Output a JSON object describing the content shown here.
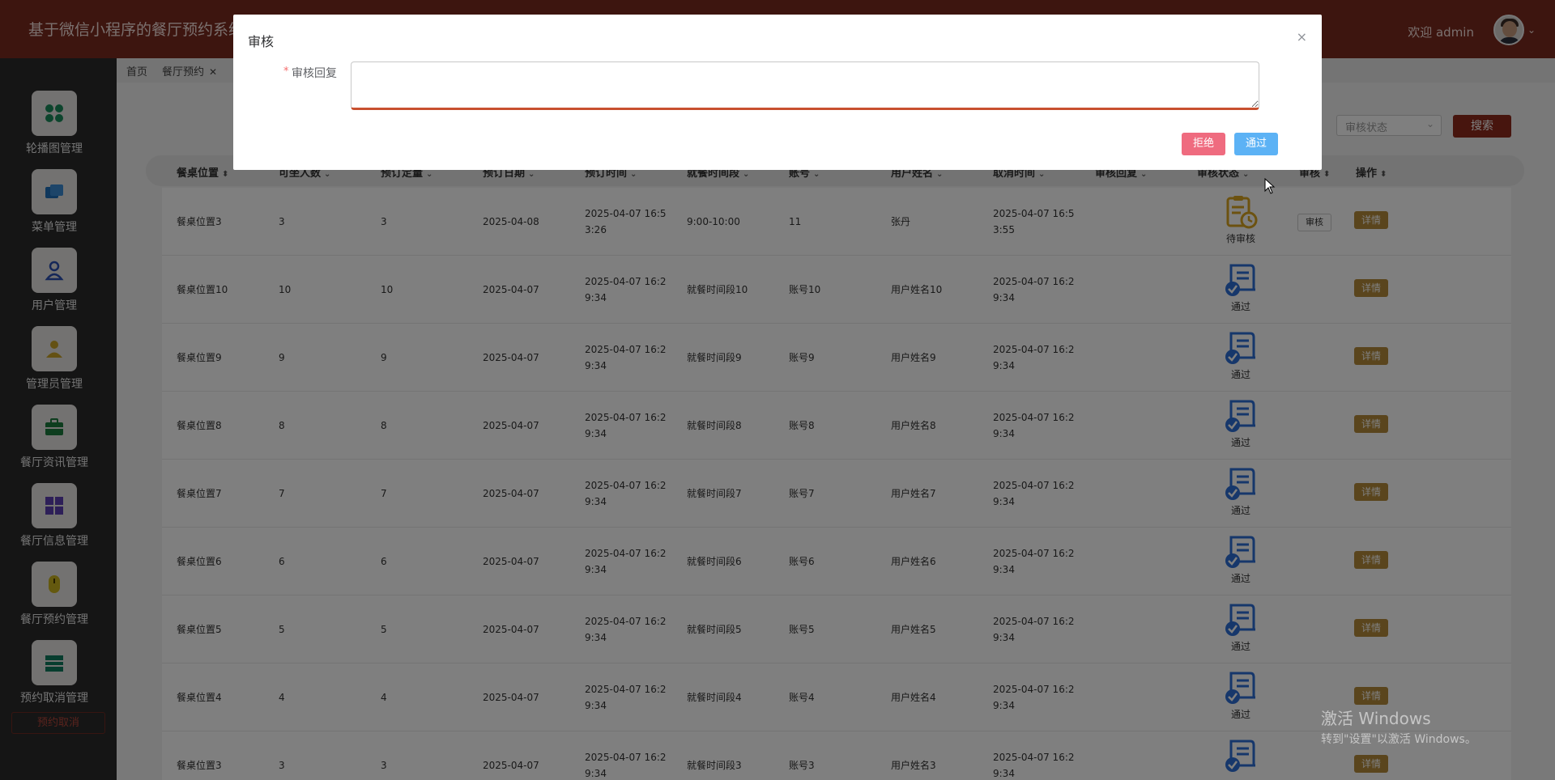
{
  "header": {
    "app_title": "基于微信小程序的餐厅预约系统",
    "welcome": "欢迎 admin"
  },
  "sidebar": {
    "items": [
      {
        "label": "轮播图管理",
        "icon": "carousel-icon",
        "color": "#1a8a5a"
      },
      {
        "label": "菜单管理",
        "icon": "menu-icon",
        "color": "#1e6fb8"
      },
      {
        "label": "用户管理",
        "icon": "user-icon",
        "color": "#2a4fb0"
      },
      {
        "label": "管理员管理",
        "icon": "admin-icon",
        "color": "#c9a227"
      },
      {
        "label": "餐厅资讯管理",
        "icon": "news-icon",
        "color": "#1b7a3c"
      },
      {
        "label": "餐厅信息管理",
        "icon": "info-icon",
        "color": "#5b3fb0"
      },
      {
        "label": "餐厅预约管理",
        "icon": "reservation-icon",
        "color": "#c9b21f"
      },
      {
        "label": "预约取消管理",
        "icon": "cancel-icon",
        "color": "#0f7a5c"
      }
    ],
    "active_item": "预约取消"
  },
  "tabs": [
    {
      "label": "首页"
    },
    {
      "label": "餐厅预约",
      "close": "✕"
    }
  ],
  "search": {
    "status_label": "审核状态",
    "status_placeholder": "审核状态",
    "search_button": "搜索"
  },
  "table": {
    "columns": [
      "餐桌位置",
      "可坐人数",
      "预订定量",
      "预订日期",
      "预订时间",
      "就餐时间段",
      "账号",
      "用户姓名",
      "取消时间",
      "审核回复",
      "审核状态",
      "审核",
      "操作"
    ],
    "rows": [
      {
        "cells": [
          "餐桌位置3",
          "3",
          "3",
          "2025-04-08",
          "2025-04-07 16:53:26",
          "9:00-10:00",
          "11",
          "张丹",
          "2025-04-07 16:53:55"
        ],
        "status": "待审核",
        "audit": "审核",
        "detail": "详情"
      },
      {
        "cells": [
          "餐桌位置10",
          "10",
          "10",
          "2025-04-07",
          "2025-04-07 16:29:34",
          "就餐时间段10",
          "账号10",
          "用户姓名10",
          "2025-04-07 16:29:34"
        ],
        "status": "通过",
        "detail": "详情"
      },
      {
        "cells": [
          "餐桌位置9",
          "9",
          "9",
          "2025-04-07",
          "2025-04-07 16:29:34",
          "就餐时间段9",
          "账号9",
          "用户姓名9",
          "2025-04-07 16:29:34"
        ],
        "status": "通过",
        "detail": "详情"
      },
      {
        "cells": [
          "餐桌位置8",
          "8",
          "8",
          "2025-04-07",
          "2025-04-07 16:29:34",
          "就餐时间段8",
          "账号8",
          "用户姓名8",
          "2025-04-07 16:29:34"
        ],
        "status": "通过",
        "detail": "详情"
      },
      {
        "cells": [
          "餐桌位置7",
          "7",
          "7",
          "2025-04-07",
          "2025-04-07 16:29:34",
          "就餐时间段7",
          "账号7",
          "用户姓名7",
          "2025-04-07 16:29:34"
        ],
        "status": "通过",
        "detail": "详情"
      },
      {
        "cells": [
          "餐桌位置6",
          "6",
          "6",
          "2025-04-07",
          "2025-04-07 16:29:34",
          "就餐时间段6",
          "账号6",
          "用户姓名6",
          "2025-04-07 16:29:34"
        ],
        "status": "通过",
        "detail": "详情"
      },
      {
        "cells": [
          "餐桌位置5",
          "5",
          "5",
          "2025-04-07",
          "2025-04-07 16:29:34",
          "就餐时间段5",
          "账号5",
          "用户姓名5",
          "2025-04-07 16:29:34"
        ],
        "status": "通过",
        "detail": "详情"
      },
      {
        "cells": [
          "餐桌位置4",
          "4",
          "4",
          "2025-04-07",
          "2025-04-07 16:29:34",
          "就餐时间段4",
          "账号4",
          "用户姓名4",
          "2025-04-07 16:29:34"
        ],
        "status": "通过",
        "detail": "详情"
      },
      {
        "cells": [
          "餐桌位置3",
          "3",
          "3",
          "2025-04-07",
          "2025-04-07 16:29:34",
          "就餐时间段3",
          "账号3",
          "用户姓名3",
          "2025-04-07 16:29:34"
        ],
        "status": "",
        "detail": "详情"
      }
    ]
  },
  "dialog": {
    "title": "审核",
    "close": "×",
    "required_mark": "*",
    "field_label": "审核回复",
    "textarea_value": "",
    "reject_button": "拒绝",
    "pass_button": "通过"
  },
  "watermark": {
    "line1": "激活 Windows",
    "line2": "转到\"设置\"以激活 Windows。"
  },
  "colors": {
    "header_bg": "#7b2a1e",
    "accent": "#8e2b1d",
    "pending": "#d9a520",
    "approved": "#2d6fd6",
    "reject": "#ef6b7f",
    "pass": "#5cb2f5"
  }
}
